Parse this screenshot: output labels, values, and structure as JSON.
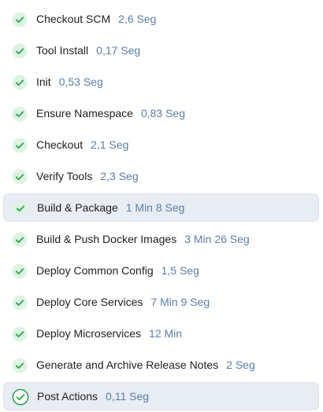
{
  "colors": {
    "success": "#2ea44f",
    "success_bg": "#dff3e4",
    "duration": "#5b7ea8",
    "highlight_bg": "#e8ecf3"
  },
  "stages": [
    {
      "name": "Checkout SCM",
      "duration": "2,6 Seg",
      "status": "success",
      "icon": "check-circle-icon"
    },
    {
      "name": "Tool Install",
      "duration": "0,17 Seg",
      "status": "success",
      "icon": "check-circle-icon"
    },
    {
      "name": "Init",
      "duration": "0,53 Seg",
      "status": "success",
      "icon": "check-circle-icon"
    },
    {
      "name": "Ensure Namespace",
      "duration": "0,83 Seg",
      "status": "success",
      "icon": "check-circle-icon"
    },
    {
      "name": "Checkout",
      "duration": "2,1 Seg",
      "status": "success",
      "icon": "check-circle-icon"
    },
    {
      "name": "Verify Tools",
      "duration": "2,3 Seg",
      "status": "success",
      "icon": "check-circle-icon"
    },
    {
      "name": "Build & Package",
      "duration": "1 Min 8 Seg",
      "status": "success",
      "icon": "check-circle-icon"
    },
    {
      "name": "Build & Push Docker Images",
      "duration": "3 Min 26 Seg",
      "status": "success",
      "icon": "check-circle-icon"
    },
    {
      "name": "Deploy Common Config",
      "duration": "1,5 Seg",
      "status": "success",
      "icon": "check-circle-icon"
    },
    {
      "name": "Deploy Core Services",
      "duration": "7 Min 9 Seg",
      "status": "success",
      "icon": "check-circle-icon"
    },
    {
      "name": "Deploy Microservices",
      "duration": "12 Min",
      "status": "success",
      "icon": "check-circle-icon"
    },
    {
      "name": "Generate and Archive Release Notes",
      "duration": "2 Seg",
      "status": "success",
      "icon": "check-circle-icon"
    },
    {
      "name": "Post Actions",
      "duration": "0,11 Seg",
      "status": "success",
      "icon": "check-circle-outline-icon"
    }
  ]
}
